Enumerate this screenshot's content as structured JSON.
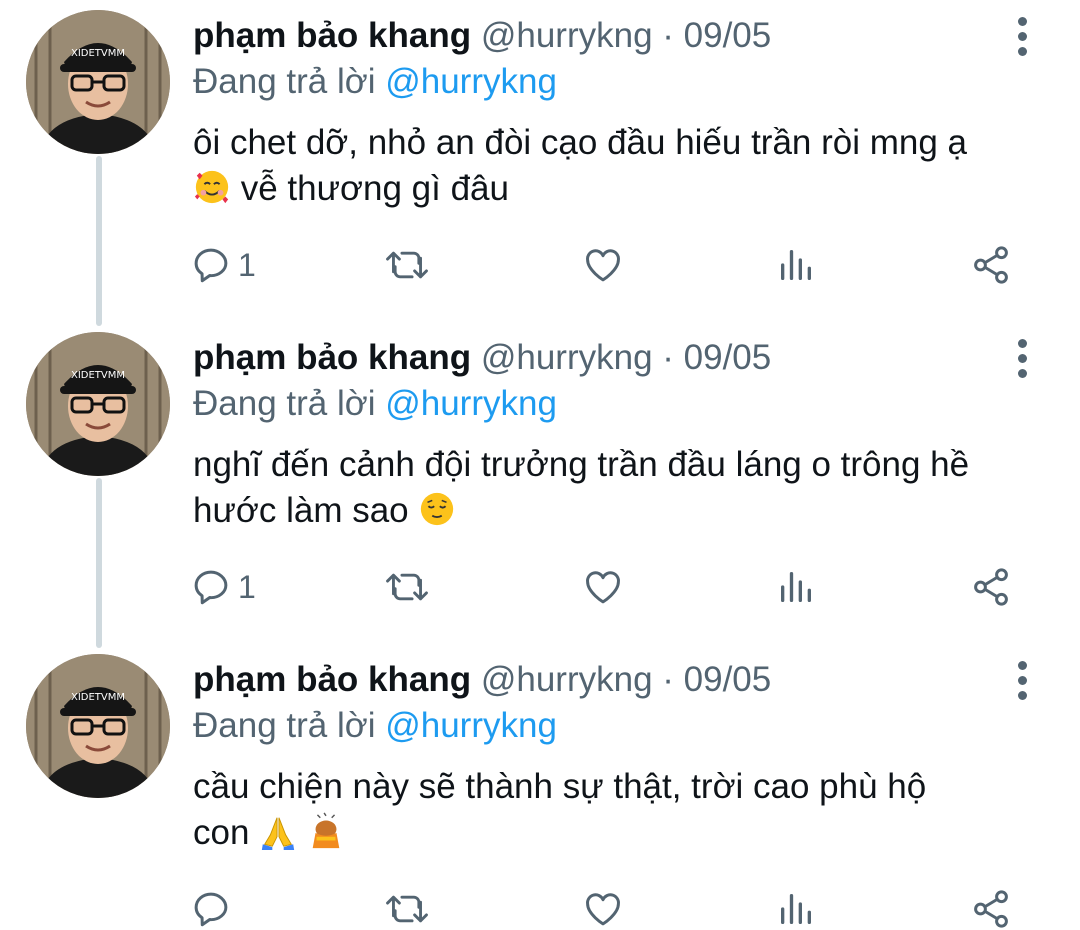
{
  "tweets": [
    {
      "name": "phạm bảo khang",
      "handle": "@hurrykng",
      "separator": "·",
      "date": "09/05",
      "replying_label": "Đang trả lời",
      "replying_to": "@hurrykng",
      "text_line1": "ôi chet dỡ, nhỏ an đòi cạo đầu hiếu trần ròi mng ạ",
      "text_line2": "vễ thương gì đâu",
      "emoji": "smiling-face-with-hearts",
      "reply_count": "1"
    },
    {
      "name": "phạm bảo khang",
      "handle": "@hurrykng",
      "separator": "·",
      "date": "09/05",
      "replying_label": "Đang trả lời",
      "replying_to": "@hurrykng",
      "text_line1": "nghĩ đến cảnh đội trưởng trần đầu láng o trông hề",
      "text_line2": "hước làm sao",
      "emoji": "relieved-face",
      "reply_count": "1"
    },
    {
      "name": "phạm bảo khang",
      "handle": "@hurrykng",
      "separator": "·",
      "date": "09/05",
      "replying_label": "Đang trả lời",
      "replying_to": "@hurrykng",
      "text_line1": "cầu chiện này sẽ thành sự thật, trời cao phù hộ",
      "text_line2": "con",
      "emoji": "folded-hands + person-bowing",
      "reply_count": ""
    }
  ],
  "icons": {
    "reply": "reply-icon",
    "retweet": "retweet-icon",
    "like": "heart-icon",
    "views": "analytics-icon",
    "share": "share-icon",
    "more": "more-options-icon"
  },
  "colors": {
    "text": "#0f1419",
    "secondary": "#536471",
    "link": "#1d9bf0",
    "thread_line": "#cfd9de"
  }
}
